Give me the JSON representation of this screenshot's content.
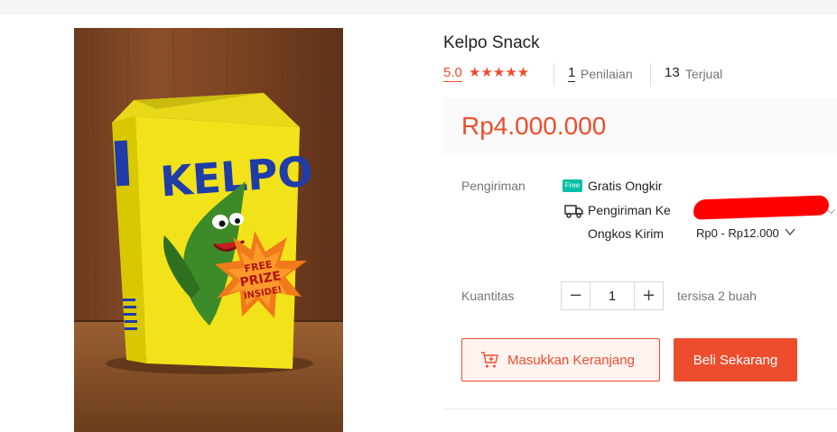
{
  "product": {
    "title": "Kelpo Snack",
    "rating": "5.0",
    "stars": "★★★★★",
    "reviews_count": "1",
    "reviews_label": "Penilaian",
    "sold_count": "13",
    "sold_label": "Terjual",
    "price": "Rp4.000.000",
    "image": {
      "brand_text": "KELPO",
      "badge_text": [
        "FREE",
        "PRIZE",
        "INSIDE!"
      ]
    }
  },
  "shipping": {
    "label": "Pengiriman",
    "free_badge": "Free",
    "free_label": "Gratis Ongkir",
    "to_label": "Pengiriman Ke",
    "cost_label": "Ongkos Kirim",
    "cost_value": "Rp0 - Rp12.000"
  },
  "quantity": {
    "label": "Kuantitas",
    "minus": "−",
    "plus": "+",
    "value": "1",
    "stock_text": "tersisa 2 buah"
  },
  "actions": {
    "cart_label": "Masukkan Keranjang",
    "buy_label": "Beli Sekarang"
  },
  "colors": {
    "accent": "#ee4d2d",
    "free_badge": "#00bfa5",
    "redaction": "#ff0000"
  }
}
